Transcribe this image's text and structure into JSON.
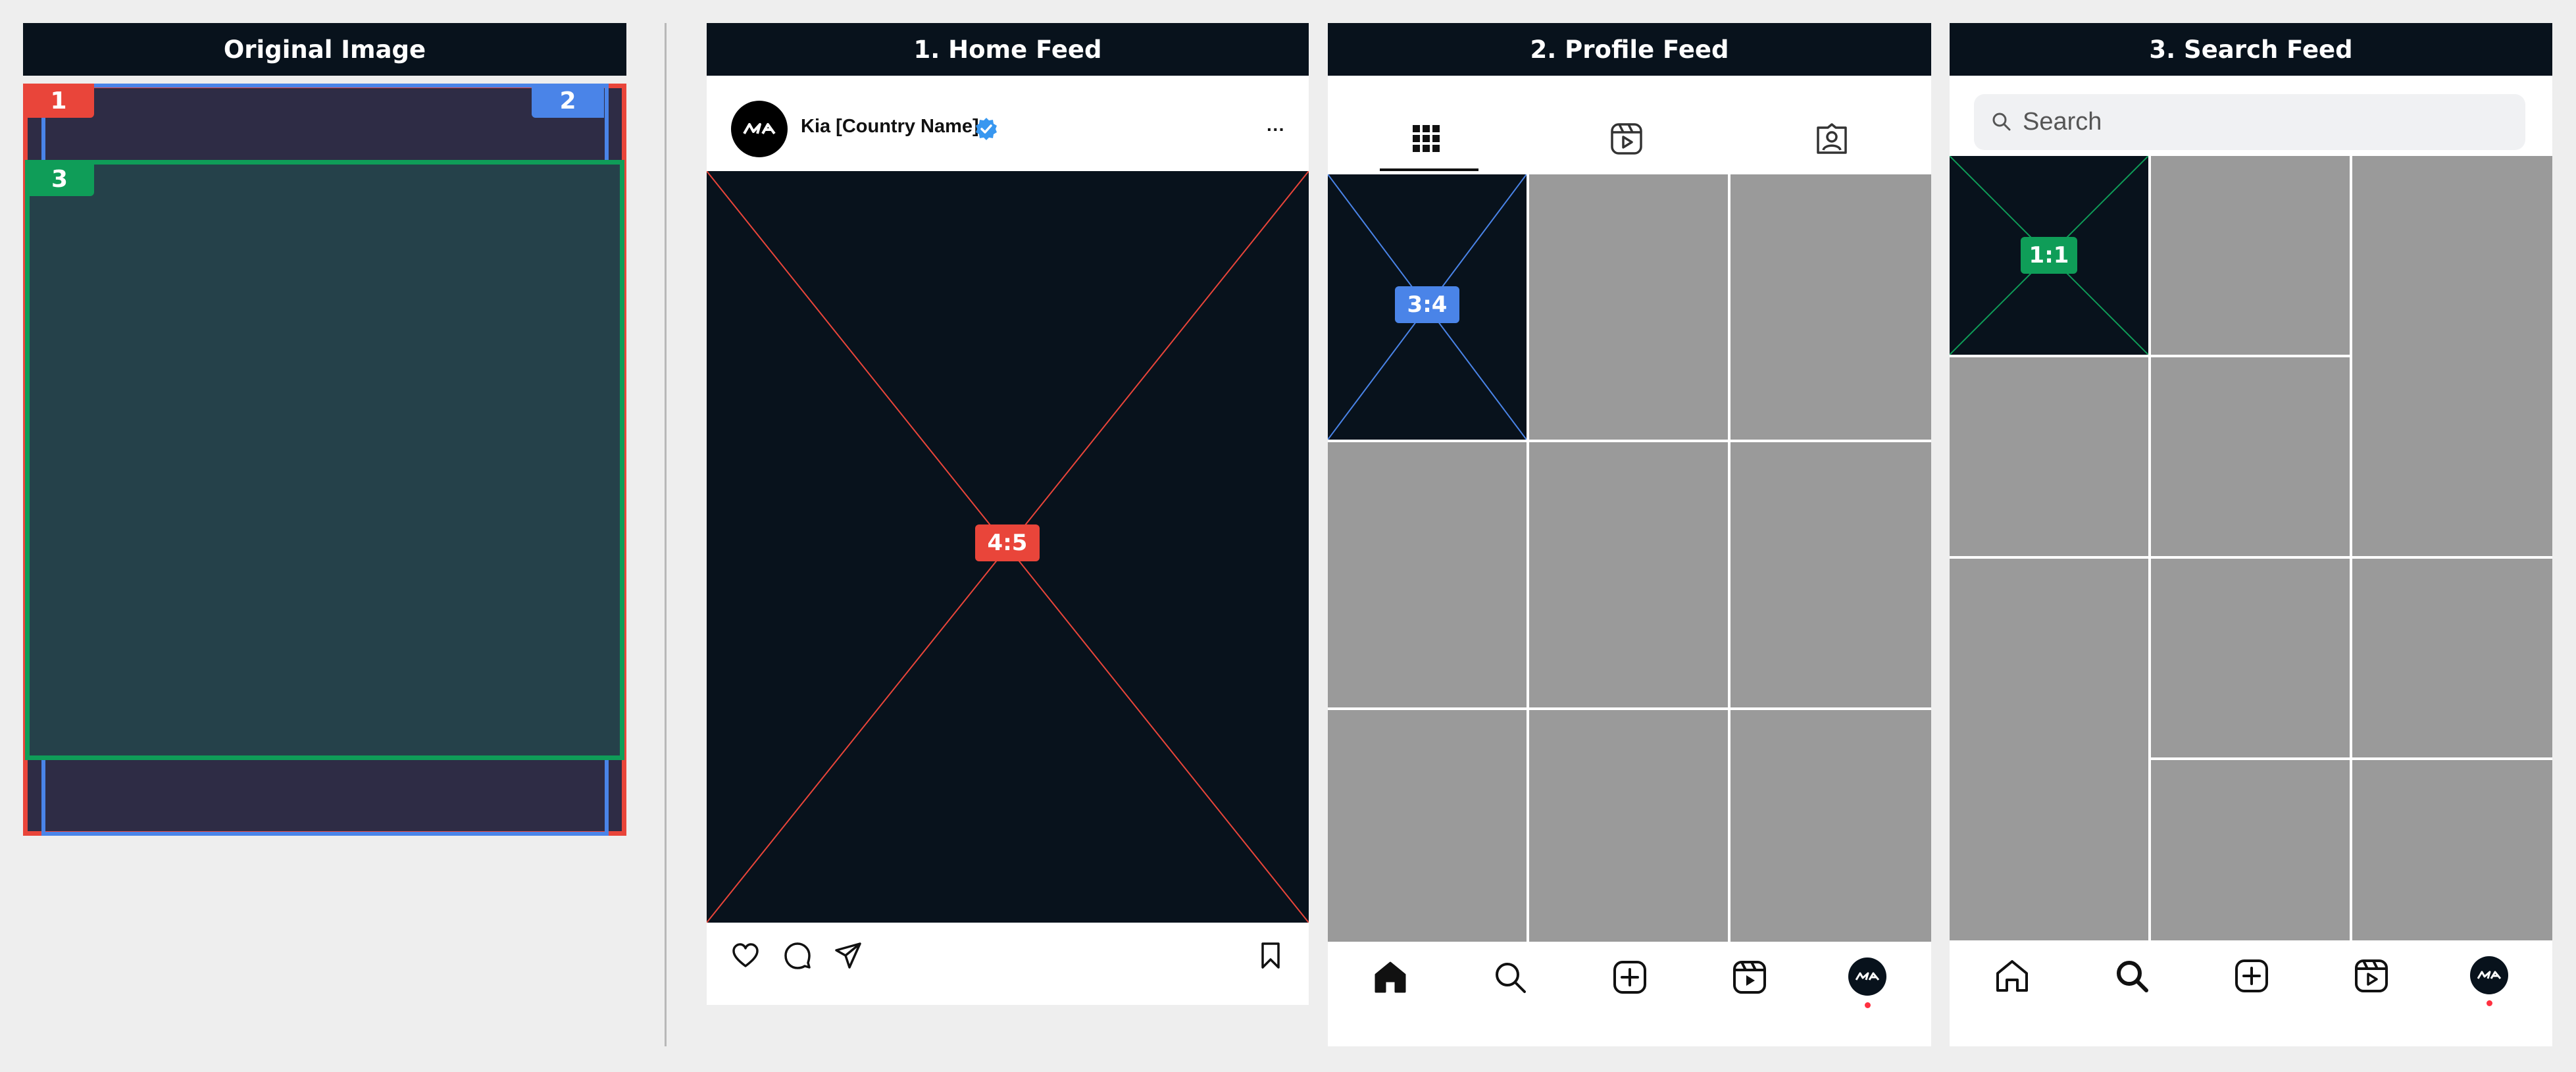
{
  "panels": {
    "original": {
      "title": "Original Image",
      "tags": [
        "1",
        "2",
        "3"
      ]
    },
    "home": {
      "title": "1. Home Feed",
      "username": "Kia [Country Name]",
      "more": "···",
      "ratio": "4:5"
    },
    "profile": {
      "title": "2. Profile Feed",
      "ratio": "3:4"
    },
    "search": {
      "title": "3. Search Feed",
      "search_placeholder": "Search",
      "ratio": "1:1"
    }
  },
  "colors": {
    "red": "#e9453a",
    "blue": "#4a84e8",
    "green": "#0f9d58",
    "dark": "#08121c",
    "grey_tile": "#9a9a9a",
    "verified": "#3897f0",
    "notification": "#ff3040"
  },
  "icons": {
    "home_actions": [
      "heart-icon",
      "comment-icon",
      "share-icon",
      "bookmark-icon"
    ],
    "profile_tabs": [
      "grid-icon",
      "reels-icon",
      "tagged-icon"
    ],
    "bottom_nav": [
      "home-icon",
      "search-icon",
      "add-icon",
      "reels-icon",
      "profile-avatar"
    ]
  }
}
